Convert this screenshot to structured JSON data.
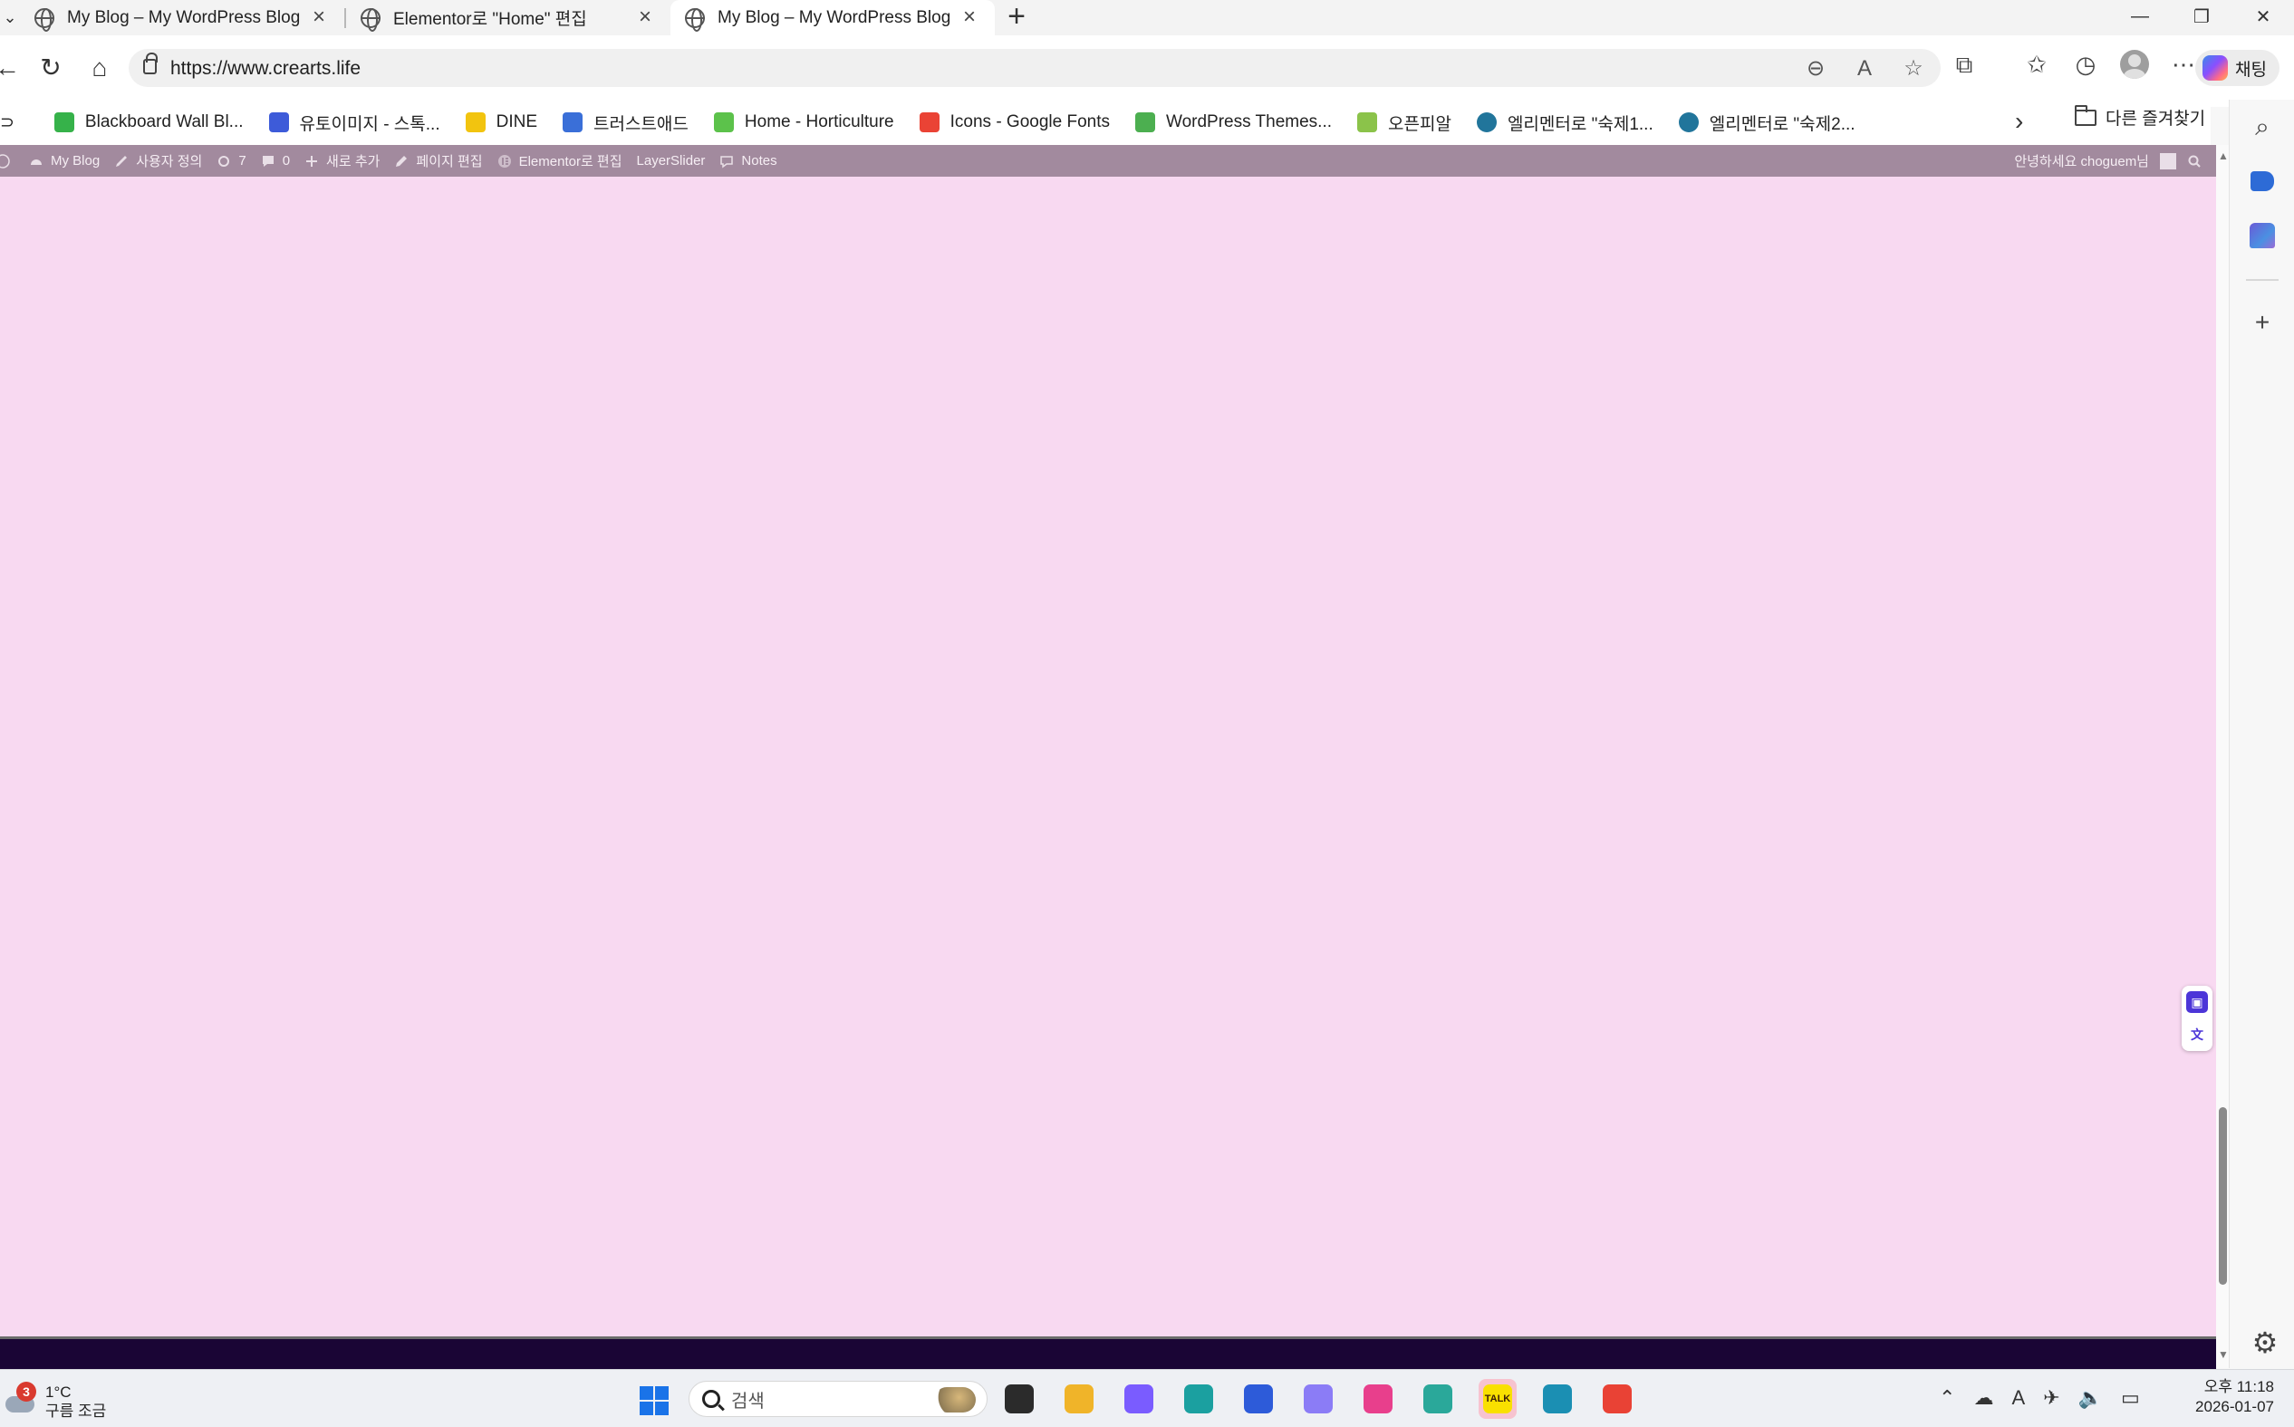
{
  "browser": {
    "tabs": [
      {
        "title": "My Blog – My WordPress Blog",
        "active": false
      },
      {
        "title": "Elementor로 \"Home\" 편집",
        "active": false
      },
      {
        "title": "My Blog – My WordPress Blog",
        "active": true
      }
    ],
    "new_tab_label": "+",
    "url": "https://www.crearts.life",
    "chat_label": "채팅"
  },
  "bookmarks": {
    "items": [
      {
        "label": "Blackboard Wall Bl...",
        "color": "#36b24a"
      },
      {
        "label": "유토이미지 - 스톡...",
        "color": "#3d5bd9"
      },
      {
        "label": "DINE",
        "color": "#f2c40f"
      },
      {
        "label": "트러스트애드",
        "color": "#3a6fd8"
      },
      {
        "label": "Home - Horticulture",
        "color": "#5cc24b"
      },
      {
        "label": "Icons - Google Fonts",
        "color": "#ea4335"
      },
      {
        "label": "WordPress Themes...",
        "color": "#4caf50"
      },
      {
        "label": "오픈피알",
        "color": "#8bc34a"
      },
      {
        "label": "엘리멘터로 \"숙제1...",
        "color": "#21759b"
      },
      {
        "label": "엘리멘터로 \"숙제2...",
        "color": "#21759b"
      }
    ],
    "other_folder_label": "다른 즐겨찾기"
  },
  "wp_admin_bar": {
    "items": [
      {
        "label": "My Blog",
        "icon": "dashboard-icon"
      },
      {
        "label": "사용자 정의",
        "icon": "brush-icon"
      },
      {
        "label": "7",
        "icon": "updates-icon"
      },
      {
        "label": "0",
        "icon": "comment-icon"
      },
      {
        "label": "새로 추가",
        "icon": "plus-icon"
      },
      {
        "label": "페이지 편집",
        "icon": "pencil-icon"
      },
      {
        "label": "Elementor로 편집",
        "icon": "elementor-icon"
      },
      {
        "label": "LayerSlider",
        "icon": ""
      },
      {
        "label": "Notes",
        "icon": "notes-icon"
      }
    ],
    "greeting": "안녕하세요 choguem님"
  },
  "page": {
    "background_color": "#f8d9f1",
    "footer_color": "#1a0535"
  },
  "taskbar": {
    "weather": {
      "temp": "1°C",
      "desc": "구름 조금",
      "badge": "3"
    },
    "search_placeholder": "검색",
    "apps": [
      {
        "name": "task-view-icon",
        "color": "#2b2b2b"
      },
      {
        "name": "file-explorer-icon",
        "color": "#f0b429"
      },
      {
        "name": "copilot-icon",
        "color": "#7a5cff"
      },
      {
        "name": "edge-icon",
        "color": "#1ba0a0"
      },
      {
        "name": "store-icon",
        "color": "#2d5bd9"
      },
      {
        "name": "app-purple-icon",
        "color": "#8b7cf6"
      },
      {
        "name": "app-pink-icon",
        "color": "#e83f8c"
      },
      {
        "name": "app-teal-icon",
        "color": "#2aa89a"
      },
      {
        "name": "kakaotalk-icon",
        "color": "#f9e000",
        "label": "TALK"
      },
      {
        "name": "app-c-icon",
        "color": "#1b8fb3"
      },
      {
        "name": "chrome-icon",
        "color": "#e94235"
      }
    ],
    "clock": {
      "time": "오후 11:18",
      "date": "2026-01-07"
    }
  }
}
